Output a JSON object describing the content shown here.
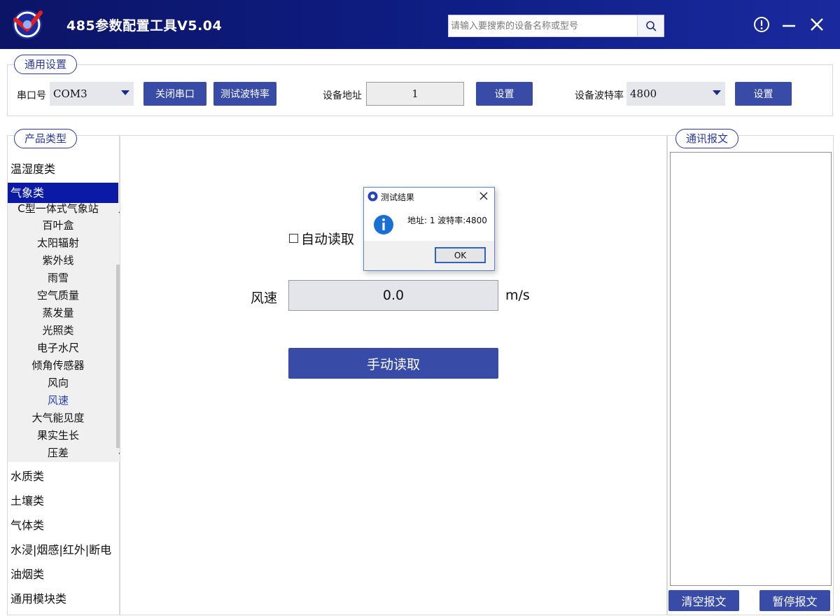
{
  "app": {
    "title": "485参数配置工具V5.04"
  },
  "search": {
    "placeholder": "请输入要搜索的设备名称或型号"
  },
  "general": {
    "group_label": "通用设置",
    "port_label": "串口号",
    "port_value": "COM3",
    "close_port_label": "关闭串口",
    "test_baud_label": "测试波特率",
    "addr_label": "设备地址",
    "addr_value": "1",
    "addr_set_label": "设置",
    "baud_label": "设备波特率",
    "baud_value": "4800",
    "baud_set_label": "设置"
  },
  "product": {
    "group_label": "产品类型",
    "categories_top": [
      "温湿度类",
      "气象类"
    ],
    "categories_bottom": [
      "水质类",
      "土壤类",
      "气体类",
      "水浸|烟感|红外|断电",
      "油烟类",
      "通用模块类"
    ],
    "active_category": "气象类",
    "sub_items": [
      "C型一体式气象站",
      "百叶盒",
      "太阳辐射",
      "紫外线",
      "雨雪",
      "空气质量",
      "蒸发量",
      "光照类",
      "电子水尺",
      "倾角传感器",
      "风向",
      "风速",
      "大气能见度",
      "果实生长",
      "压差"
    ],
    "selected_sub": "风速"
  },
  "main": {
    "auto_read_label": "自动读取",
    "auto_read_checked": false,
    "wind_label": "风速",
    "wind_value": "0.0",
    "wind_unit": "m/s",
    "manual_read_label": "手动读取"
  },
  "dialog": {
    "title": "测试结果",
    "message": "地址: 1  波特率:4800",
    "ok_label": "OK"
  },
  "comm": {
    "group_label": "通讯报文",
    "clear_label": "清空报文",
    "pause_label": "暂停报文"
  },
  "colors": {
    "titlebar": "#0f1e86",
    "accent": "#384ba6",
    "active_category": "#0a1aa6"
  }
}
